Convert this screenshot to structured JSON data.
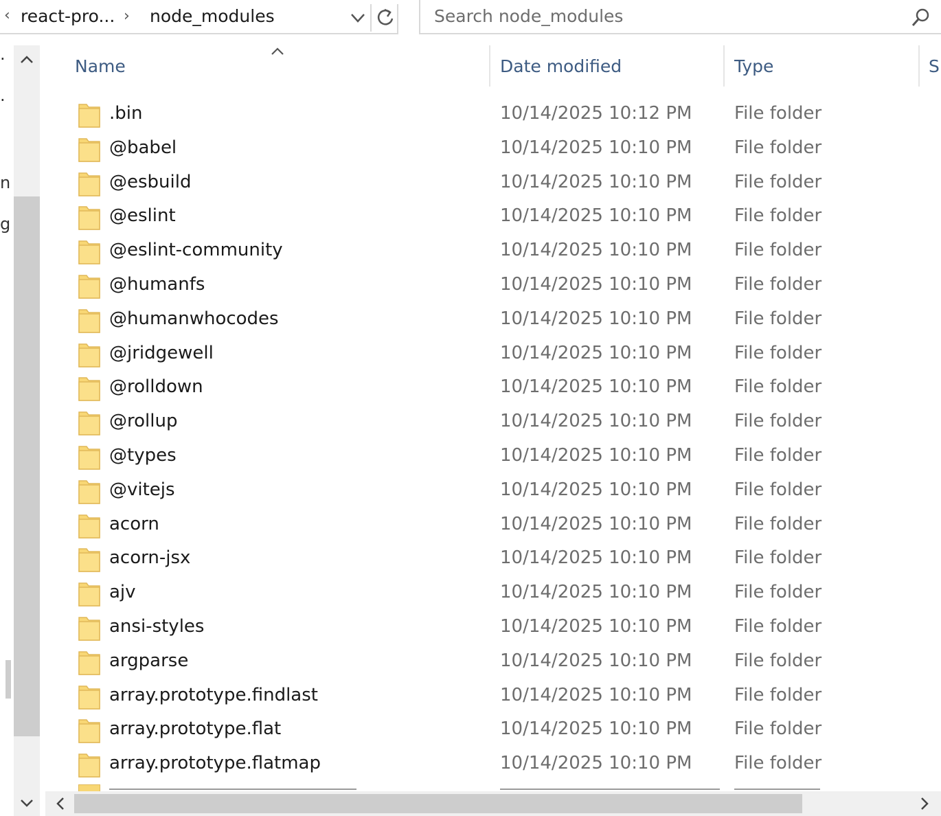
{
  "address_bar": {
    "back_glyph": "‹",
    "crumbs": [
      "react-pro...",
      "node_modules"
    ],
    "separator": "›"
  },
  "search": {
    "placeholder": "Search node_modules"
  },
  "left_fragments": [
    "·",
    "·",
    "n",
    "g"
  ],
  "columns": {
    "name": "Name",
    "date": "Date modified",
    "type": "Type",
    "size_partial": "S"
  },
  "files": [
    {
      "name": ".bin",
      "date": "10/14/2025 10:12 PM",
      "type": "File folder"
    },
    {
      "name": "@babel",
      "date": "10/14/2025 10:10 PM",
      "type": "File folder"
    },
    {
      "name": "@esbuild",
      "date": "10/14/2025 10:10 PM",
      "type": "File folder"
    },
    {
      "name": "@eslint",
      "date": "10/14/2025 10:10 PM",
      "type": "File folder"
    },
    {
      "name": "@eslint-community",
      "date": "10/14/2025 10:10 PM",
      "type": "File folder"
    },
    {
      "name": "@humanfs",
      "date": "10/14/2025 10:10 PM",
      "type": "File folder"
    },
    {
      "name": "@humanwhocodes",
      "date": "10/14/2025 10:10 PM",
      "type": "File folder"
    },
    {
      "name": "@jridgewell",
      "date": "10/14/2025 10:10 PM",
      "type": "File folder"
    },
    {
      "name": "@rolldown",
      "date": "10/14/2025 10:10 PM",
      "type": "File folder"
    },
    {
      "name": "@rollup",
      "date": "10/14/2025 10:10 PM",
      "type": "File folder"
    },
    {
      "name": "@types",
      "date": "10/14/2025 10:10 PM",
      "type": "File folder"
    },
    {
      "name": "@vitejs",
      "date": "10/14/2025 10:10 PM",
      "type": "File folder"
    },
    {
      "name": "acorn",
      "date": "10/14/2025 10:10 PM",
      "type": "File folder"
    },
    {
      "name": "acorn-jsx",
      "date": "10/14/2025 10:10 PM",
      "type": "File folder"
    },
    {
      "name": "ajv",
      "date": "10/14/2025 10:10 PM",
      "type": "File folder"
    },
    {
      "name": "ansi-styles",
      "date": "10/14/2025 10:10 PM",
      "type": "File folder"
    },
    {
      "name": "argparse",
      "date": "10/14/2025 10:10 PM",
      "type": "File folder"
    },
    {
      "name": "array.prototype.findlast",
      "date": "10/14/2025 10:10 PM",
      "type": "File folder"
    },
    {
      "name": "array.prototype.flat",
      "date": "10/14/2025 10:10 PM",
      "type": "File folder"
    },
    {
      "name": "array.prototype.flatmap",
      "date": "10/14/2025 10:10 PM",
      "type": "File folder"
    }
  ],
  "icons": {
    "folder": "folder-icon",
    "dropdown": "chevron-down-icon",
    "refresh": "refresh-icon",
    "search": "search-icon",
    "sort": "sort-ascending-icon"
  },
  "colors": {
    "header_text": "#3d5b82",
    "folder_fill": "#f8d775",
    "secondary_text": "#6d6d6d"
  }
}
